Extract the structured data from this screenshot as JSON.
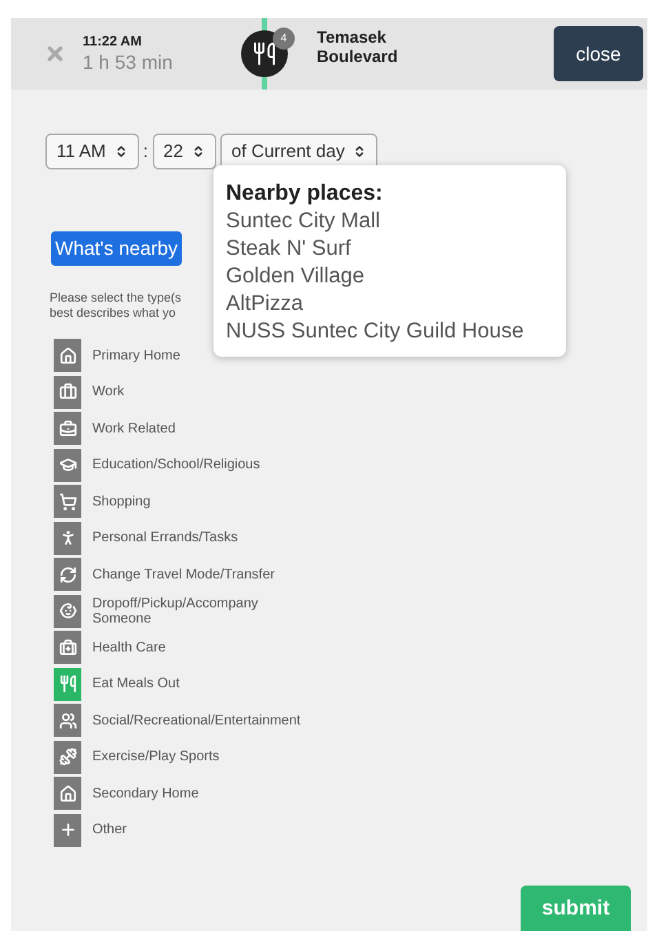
{
  "header": {
    "time": "11:22 AM",
    "duration": "1 h 53 min",
    "badge": "4",
    "place": [
      "Temasek",
      "Boulevard"
    ],
    "close_button": "close"
  },
  "time_selects": [
    {
      "value": "11 AM"
    },
    {
      "value": "22"
    },
    {
      "value": "of Current day"
    }
  ],
  "separator": ":",
  "nearby_button": "What's nearby",
  "instructions": [
    "Please select the type(s",
    "best describes what yo"
  ],
  "popover": {
    "title": "Nearby places:",
    "places": [
      "Suntec City Mall",
      "Steak N' Surf",
      "Golden Village",
      "AltPizza",
      "NUSS Suntec City Guild House"
    ]
  },
  "categories": [
    {
      "label": "Primary Home",
      "selected": false
    },
    {
      "label": "Work",
      "selected": false
    },
    {
      "label": "Work Related",
      "selected": false
    },
    {
      "label": "Education/School/Religious",
      "selected": false
    },
    {
      "label": "Shopping",
      "selected": false
    },
    {
      "label": "Personal Errands/Tasks",
      "selected": false
    },
    {
      "label": "Change Travel Mode/Transfer",
      "selected": false
    },
    {
      "label": "Dropoff/Pickup/Accompany Someone",
      "selected": false
    },
    {
      "label": "Health Care",
      "selected": false
    },
    {
      "label": "Eat Meals Out",
      "selected": true
    },
    {
      "label": "Social/Recreational/Entertainment",
      "selected": false
    },
    {
      "label": "Exercise/Play Sports",
      "selected": false
    },
    {
      "label": "Secondary Home",
      "selected": false
    },
    {
      "label": "Other",
      "selected": false
    }
  ],
  "submit_button": "submit"
}
